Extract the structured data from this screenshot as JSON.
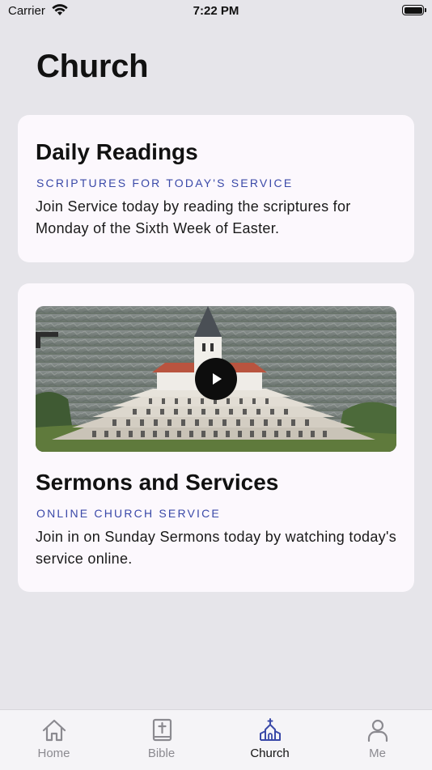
{
  "status_bar": {
    "carrier": "Carrier",
    "time": "7:22 PM"
  },
  "page": {
    "title": "Church"
  },
  "cards": [
    {
      "title": "Daily Readings",
      "subtitle": "SCRIPTURES FOR TODAY'S SERVICE",
      "body": "Join Service today by reading the scriptures for Monday of the Sixth Week of Easter."
    },
    {
      "title": "Sermons and Services",
      "subtitle": "ONLINE CHURCH SERVICE",
      "body": "Join in on Sunday Sermons today by watching today's service online."
    }
  ],
  "tabs": [
    {
      "label": "Home",
      "icon": "home-icon"
    },
    {
      "label": "Bible",
      "icon": "bible-icon"
    },
    {
      "label": "Church",
      "icon": "church-icon",
      "active": true
    },
    {
      "label": "Me",
      "icon": "person-icon"
    }
  ],
  "colors": {
    "accent": "#3a49a8",
    "background": "#e6e5ea",
    "card": "#fcf8fd",
    "inactive_tab": "#8b8a90"
  }
}
